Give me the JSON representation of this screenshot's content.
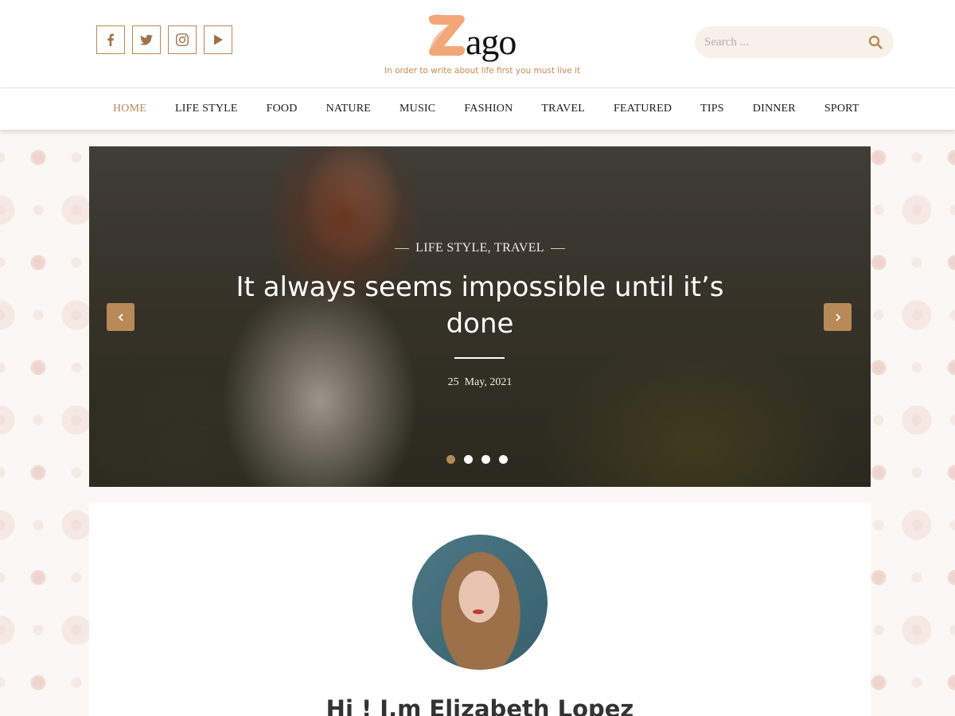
{
  "header": {
    "socials": [
      {
        "icon": "facebook-icon",
        "label": "f"
      },
      {
        "icon": "twitter-icon",
        "label": "twitter"
      },
      {
        "icon": "instagram-icon",
        "label": "instagram"
      },
      {
        "icon": "youtube-icon",
        "label": "youtube"
      }
    ],
    "logo_text": "ago",
    "tagline": "In order to write about life first you must live it",
    "search_placeholder": "Search ..."
  },
  "nav": {
    "items": [
      "HOME",
      "LIFE STYLE",
      "FOOD",
      "NATURE",
      "MUSIC",
      "FASHION",
      "TRAVEL",
      "FEATURED",
      "TIPS",
      "DINNER",
      "SPORT"
    ],
    "active_index": 0
  },
  "slider": {
    "categories": "LIFE STYLE, TRAVEL",
    "title": "It always seems impossible until it’s done",
    "date": "25  May, 2021",
    "slide_count": 4,
    "active_slide": 0
  },
  "about": {
    "name": "Hi ! I,m Elizabeth Lopez"
  },
  "colors": {
    "accent": "#b78a57",
    "logo_orange": "#f2a779",
    "tagline": "#c98a4e"
  }
}
